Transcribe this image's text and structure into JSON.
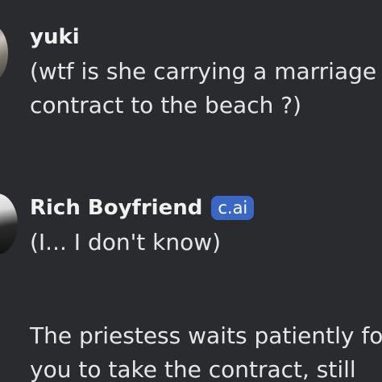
{
  "messages": [
    {
      "author": "yuki",
      "lines": [
        "(wtf is she carrying a marriage",
        "contract to the beach ?)"
      ]
    },
    {
      "author": "Rich Boyfriend",
      "badge": "c.ai",
      "lines": [
        "(I... I don't know)"
      ],
      "narration_lines": [
        "The priestess waits patiently for",
        "you to take the contract, still"
      ]
    }
  ]
}
